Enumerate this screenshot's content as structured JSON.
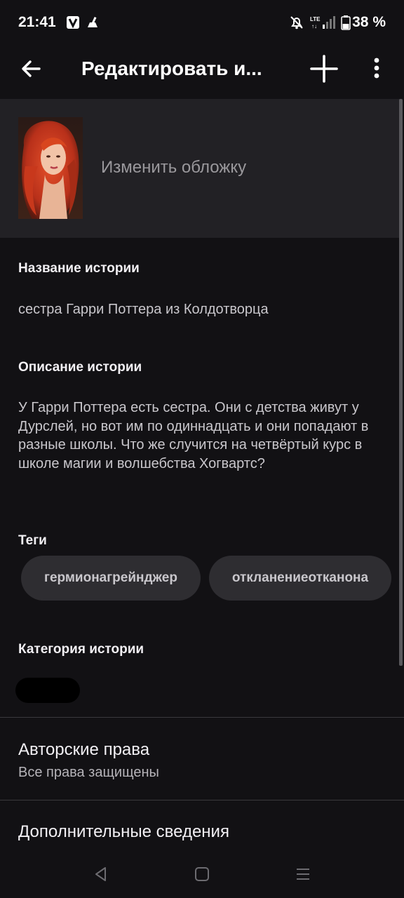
{
  "status_bar": {
    "time": "21:41",
    "battery_percent": "38 %",
    "icons": [
      "app-notification-icon",
      "cleaner-icon",
      "mute-bell-icon",
      "lte-signal-icon",
      "battery-icon"
    ]
  },
  "app_bar": {
    "title": "Редактировать и...",
    "icons": [
      "back-arrow-icon",
      "plus-icon",
      "more-vertical-icon"
    ]
  },
  "cover": {
    "change_label": "Изменить обложку"
  },
  "story_title": {
    "label": "Название истории",
    "value": "сестра Гарри Поттера из Колдотворца"
  },
  "story_description": {
    "label": "Описание истории",
    "value": "У Гарри Поттера есть сестра. Они с детства живут у Дурслей, но вот им по одиннадцать и они попадают в разные школы. Что же случится на четвёртый курс в школе магии и волшебства Хогвартс?"
  },
  "tags": {
    "label": "Теги",
    "items": [
      "гермионагрейнджер",
      "откланениеотканона"
    ]
  },
  "category": {
    "label": "Категория истории"
  },
  "copyright": {
    "title": "Авторские права",
    "value": "Все права защищены"
  },
  "additional": {
    "title": "Дополнительные сведения"
  },
  "nav_bar": {
    "icons": [
      "back-triangle-icon",
      "home-square-icon",
      "recents-lines-icon"
    ]
  },
  "colors": {
    "background": "#121114",
    "cover_panel": "#222125",
    "tag_chip": "#2e2d31"
  }
}
